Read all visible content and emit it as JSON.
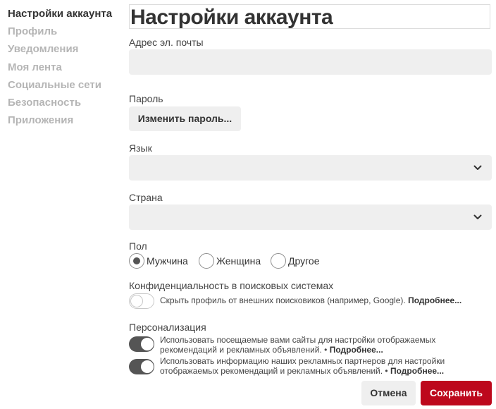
{
  "sidebar": {
    "items": [
      {
        "label": "Настройки аккаунта"
      },
      {
        "label": "Профиль"
      },
      {
        "label": "Уведомления"
      },
      {
        "label": "Моя лента"
      },
      {
        "label": "Социальные сети"
      },
      {
        "label": "Безопасность"
      },
      {
        "label": "Приложения"
      }
    ]
  },
  "main": {
    "title": "Настройки аккаунта",
    "email": {
      "label": "Адрес эл. почты",
      "value": ""
    },
    "password": {
      "label": "Пароль",
      "button": "Изменить пароль..."
    },
    "language": {
      "label": "Язык",
      "value": ""
    },
    "country": {
      "label": "Страна",
      "value": ""
    },
    "gender": {
      "label": "Пол",
      "options": [
        {
          "label": "Мужчина",
          "checked": true
        },
        {
          "label": "Женщина",
          "checked": false
        },
        {
          "label": "Другое",
          "checked": false
        }
      ]
    },
    "privacy": {
      "label": "Конфиденциальность в поисковых системах",
      "toggle_text": "Скрыть профиль от внешних поисковиков (например, Google).",
      "more": "Подробнее...",
      "on": false
    },
    "personalization": {
      "label": "Персонализация",
      "items": [
        {
          "text": "Использовать посещаемые вами сайты для настройки отображаемых рекомендаций и рекламных объявлений. •",
          "more": "Подробнее...",
          "on": true
        },
        {
          "text": "Использовать информацию наших рекламных партнеров для настройки отображаемых рекомендаций и рекламных объявлений. •",
          "more": "Подробнее...",
          "on": true
        }
      ]
    }
  },
  "footer": {
    "cancel": "Отмена",
    "save": "Сохранить"
  },
  "colors": {
    "accent": "#bd081c",
    "field_bg": "#efefef",
    "muted": "#b5b5b5"
  }
}
